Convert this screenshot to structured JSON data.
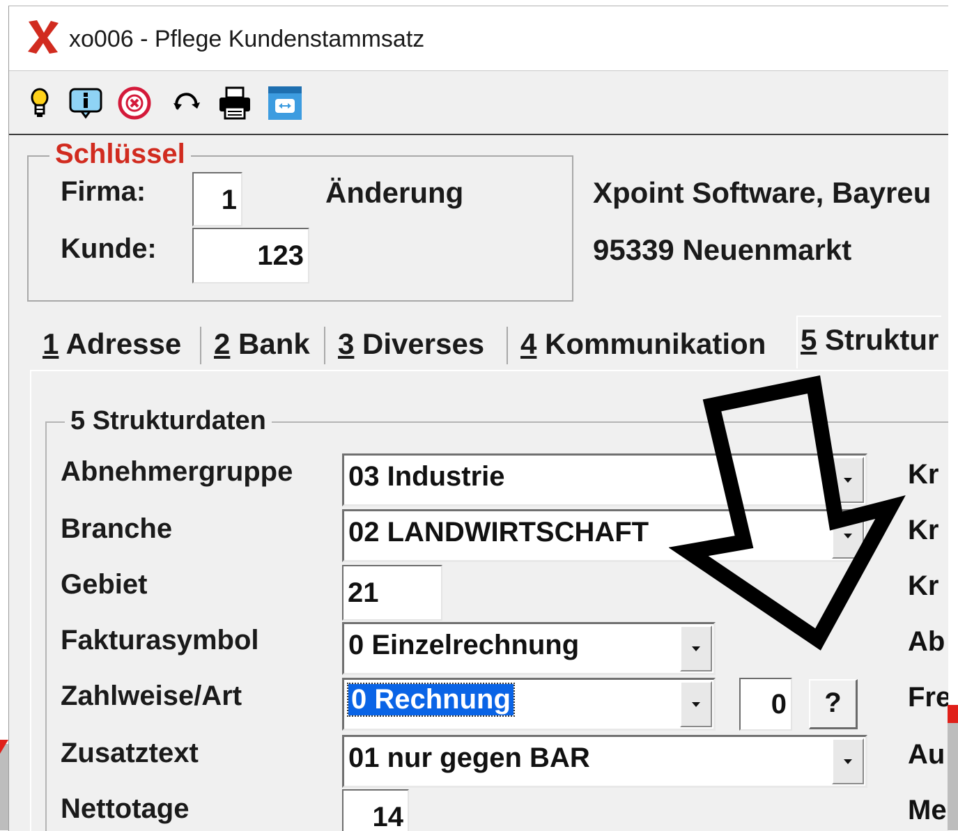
{
  "window": {
    "title": "xo006 - Pflege Kundenstammsatz",
    "app_icon": "red-x-logo-icon"
  },
  "toolbar": {
    "icons": [
      "lightbulb-icon",
      "info-icon",
      "cancel-circle-icon",
      "refresh-icon",
      "print-icon",
      "resize-icon"
    ]
  },
  "key_group": {
    "legend": "Schlüssel",
    "firma_label": "Firma:",
    "firma_value": "1",
    "kunde_label": "Kunde:",
    "kunde_value": "123",
    "mode": "Änderung",
    "customer_name": "Xpoint Software, Bayreu",
    "customer_city": "95339 Neuenmarkt"
  },
  "tabs": [
    {
      "num": "1",
      "label": "Adresse"
    },
    {
      "num": "2",
      "label": "Bank"
    },
    {
      "num": "3",
      "label": "Diverses"
    },
    {
      "num": "4",
      "label": "Kommunikation"
    },
    {
      "num": "5",
      "label": "Struktur"
    }
  ],
  "struktur": {
    "legend": "5 Strukturdaten",
    "abnehmergruppe_label": "Abnehmergruppe",
    "abnehmergruppe_value": "03 Industrie",
    "branche_label": "Branche",
    "branche_value": "02 LANDWIRTSCHAFT",
    "gebiet_label": "Gebiet",
    "gebiet_value": "21",
    "fakturasymbol_label": "Fakturasymbol",
    "fakturasymbol_value": "0 Einzelrechnung",
    "zahlweise_label": "Zahlweise/Art",
    "zahlweise_value": "0 Rechnung",
    "zahlweise_art_value": "0",
    "help_button": "?",
    "zusatztext_label": "Zusatztext",
    "zusatztext_value": "01 nur gegen BAR",
    "nettotage_label": "Nettotage",
    "nettotage_value": "14"
  },
  "right_column_labels": [
    "Kr",
    "Kr",
    "Kr",
    "Ab",
    "Fre",
    "Au",
    "Me"
  ],
  "colors": {
    "accent_red": "#d12b1f",
    "selection_blue": "#0a64e6",
    "window_bg": "#f0f0f0"
  }
}
